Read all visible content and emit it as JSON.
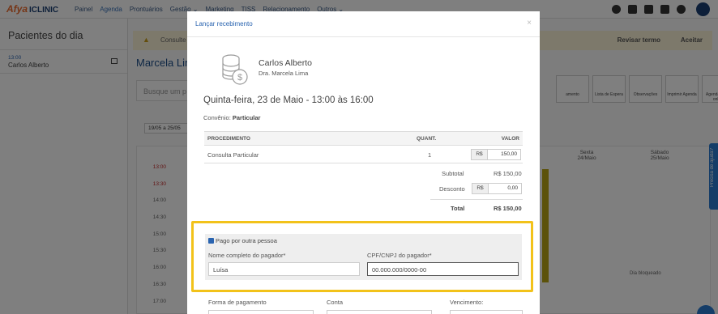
{
  "app": {
    "logo_main": "Afya",
    "logo_sub": "ICLINIC",
    "nav": [
      "Painel",
      "Agenda",
      "Prontuários",
      "Gestão ⌄",
      "Marketing",
      "TISS",
      "Relacionamento",
      "Outros ⌄"
    ],
    "left_title": "Pacientes do dia",
    "left_item_time": "13:00",
    "left_item_name": "Carlos Alberto",
    "banner_text": "Consulte as",
    "banner_review": "Revisar termo",
    "banner_accept": "Aceitar",
    "patient_title": "Marcela Lim",
    "search_placeholder": "Busque um p",
    "actions": [
      "amento",
      "Lista de Espera",
      "Observações",
      "Imprimir Agenda",
      "Agendamento online"
    ],
    "date_range": "19/05 a 25/05",
    "hours": [
      "13:00",
      "13:30",
      "14:00",
      "14:30",
      "15:00",
      "15:30",
      "16:00",
      "16:30",
      "17:00"
    ],
    "days": [
      {
        "name": "Sexta",
        "date": "24/Maio"
      },
      {
        "name": "Sábado",
        "date": "25/Maio"
      }
    ],
    "blocked_label": "Dia bloqueado",
    "help_label": "Precisa de ajuda?"
  },
  "modal": {
    "title": "Lançar recebimento",
    "close": "×",
    "patient_name": "Carlos Alberto",
    "doctor": "Dra. Marcela Lima",
    "date": "Quinta-feira, 23 de Maio - 13:00 às 16:00",
    "convenio_label": "Convênio:",
    "convenio_value": "Particular",
    "table": {
      "headers": {
        "procedure": "PROCEDIMENTO",
        "quantity": "QUANT.",
        "value": "VALOR"
      },
      "rows": [
        {
          "procedure": "Consulta Particular",
          "quantity": "1",
          "currency": "R$",
          "value": "150,00"
        }
      ]
    },
    "subtotal_label": "Subtotal",
    "subtotal_value": "R$ 150,00",
    "discount_label": "Desconto",
    "discount_currency": "R$",
    "discount_value": "0,00",
    "total_label": "Total",
    "total_value": "R$ 150,00",
    "paid_by_other_label": "Pago por outra pessoa",
    "paid_by_other_checked": true,
    "payer_name_label": "Nome completo do pagador*",
    "payer_name_value": "Luísa",
    "payer_doc_label": "CPF/CNPJ do pagador*",
    "payer_doc_value": "00.000.000/0000-00",
    "payment_method_label": "Forma de pagamento",
    "account_label": "Conta",
    "due_label": "Vencimento:"
  },
  "colors": {
    "accent": "#2a64b0",
    "highlight": "#f2c21a"
  }
}
